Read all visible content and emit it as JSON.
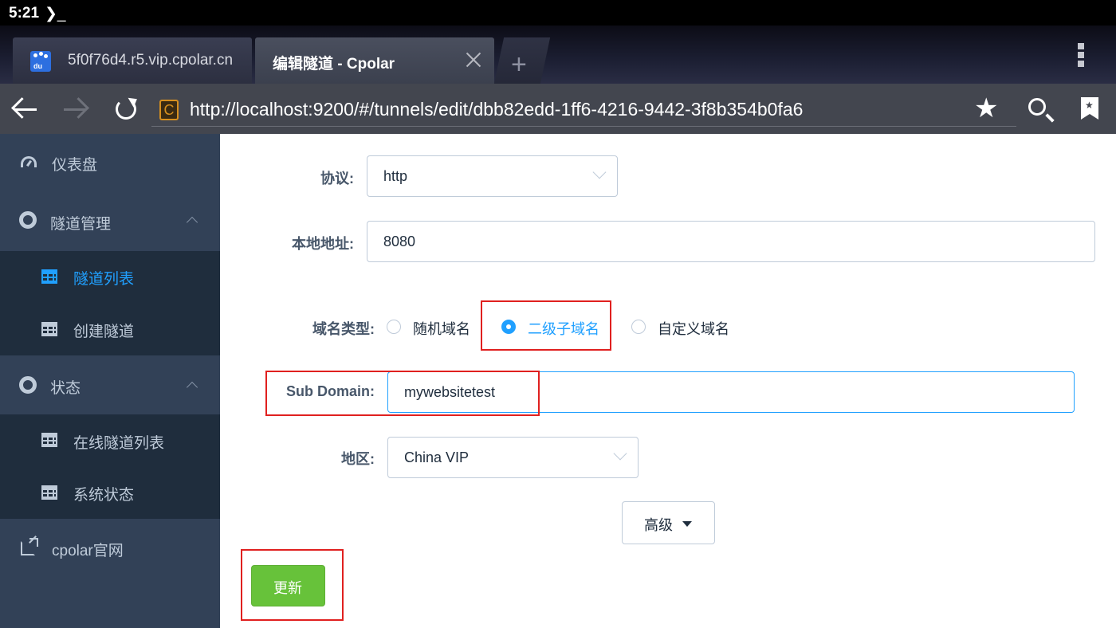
{
  "status_bar": {
    "time": "5:21",
    "terminal_glyph": "❯_"
  },
  "tabs": [
    {
      "title": "5f0f76d4.r5.vip.cpolar.cn",
      "favicon": "baidu-paw-icon",
      "favicon_text": "du"
    },
    {
      "title": "编辑隧道 - Cpolar",
      "active": true
    }
  ],
  "toolbar": {
    "url": "http://localhost:9200/#/tunnels/edit/dbb82edd-1ff6-4216-9442-3f8b354b0fa6",
    "url_favicon_letter": "C"
  },
  "sidebar": {
    "items": [
      {
        "label": "仪表盘",
        "icon": "dashboard-icon"
      },
      {
        "label": "隧道管理",
        "icon": "lifebuoy-icon",
        "expanded": true
      },
      {
        "label": "隧道列表",
        "icon": "grid-icon",
        "active": true
      },
      {
        "label": "创建隧道",
        "icon": "grid-icon"
      },
      {
        "label": "状态",
        "icon": "lifebuoy-icon",
        "expanded": true
      },
      {
        "label": "在线隧道列表",
        "icon": "grid-icon"
      },
      {
        "label": "系统状态",
        "icon": "grid-icon"
      },
      {
        "label": "cpolar官网",
        "icon": "external-link-icon"
      }
    ]
  },
  "form": {
    "protocol": {
      "label": "协议:",
      "value": "http"
    },
    "local_address": {
      "label": "本地地址:",
      "value": "8080"
    },
    "domain_type": {
      "label": "域名类型:",
      "options": [
        "随机域名",
        "二级子域名",
        "自定义域名"
      ],
      "selected": "二级子域名"
    },
    "sub_domain": {
      "label": "Sub Domain:",
      "value": "mywebsitetest"
    },
    "region": {
      "label": "地区:",
      "value": "China VIP"
    },
    "advanced_button": "高级",
    "update_button": "更新"
  },
  "colors": {
    "sidebar_bg": "#324157",
    "sidebar_sub_bg": "#1f2d3d",
    "accent": "#20a0ff",
    "update_green": "#67c23a",
    "highlight_red": "#e0201f"
  }
}
